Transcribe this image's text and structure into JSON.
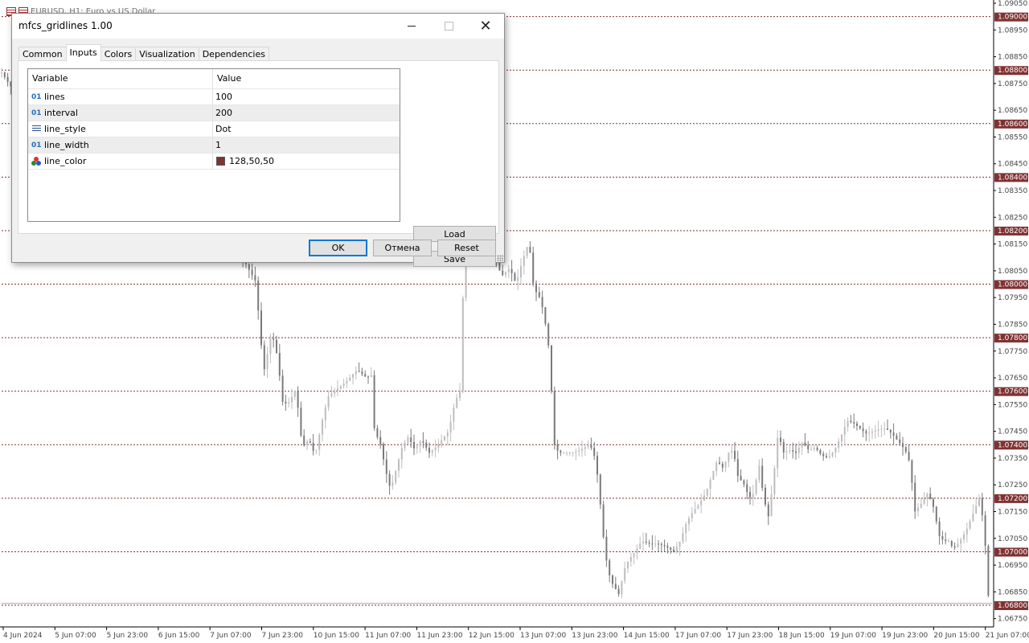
{
  "chart": {
    "symbol_title": "EURUSD, H1:  Euro vs US Dollar",
    "colors": {
      "bear_candle": "#7a7a7a",
      "bull_candle": "#bdbdbd",
      "gridline": "#803232",
      "label_bg": "#803232",
      "axis_text": "#444444"
    },
    "price_axis": {
      "min": 1.06725,
      "max": 1.0905
    },
    "price_labels": [
      "1.09050",
      "1.08950",
      "1.08850",
      "1.08750",
      "1.08650",
      "1.08550",
      "1.08450",
      "1.08350",
      "1.08250",
      "1.08150",
      "1.08050",
      "1.07950",
      "1.07850",
      "1.07750",
      "1.07650",
      "1.07550",
      "1.07450",
      "1.07350",
      "1.07250",
      "1.07150",
      "1.07050",
      "1.06950",
      "1.06850",
      "1.06750"
    ],
    "gridline_levels": [
      "1.09000",
      "1.08800",
      "1.08600",
      "1.08400",
      "1.08200",
      "1.08000",
      "1.07800",
      "1.07600",
      "1.07400",
      "1.07200",
      "1.07000",
      "1.06800"
    ],
    "time_labels": [
      "4 Jun 2024",
      "5 Jun 07:00",
      "5 Jun 23:00",
      "6 Jun 15:00",
      "7 Jun 07:00",
      "7 Jun 23:00",
      "10 Jun 15:00",
      "11 Jun 07:00",
      "11 Jun 23:00",
      "12 Jun 15:00",
      "13 Jun 07:00",
      "13 Jun 23:00",
      "14 Jun 15:00",
      "17 Jun 07:00",
      "17 Jun 23:00",
      "18 Jun 15:00",
      "19 Jun 07:00",
      "19 Jun 23:00",
      "20 Jun 15:00",
      "21 Jun 07:00"
    ],
    "last_price": 1.06807,
    "close_path": [
      [
        0,
        1.088
      ],
      [
        22,
        1.087
      ],
      [
        50,
        1.0865
      ],
      [
        80,
        1.0866
      ],
      [
        110,
        1.0865
      ],
      [
        140,
        1.0868
      ],
      [
        170,
        1.0864
      ],
      [
        200,
        1.0856
      ],
      [
        230,
        1.0848
      ],
      [
        260,
        1.0838
      ],
      [
        290,
        1.0816
      ],
      [
        318,
        1.0801
      ],
      [
        328,
        1.0767
      ],
      [
        338,
        1.0782
      ],
      [
        345,
        1.0773
      ],
      [
        352,
        1.0755
      ],
      [
        360,
        1.0756
      ],
      [
        368,
        1.0761
      ],
      [
        376,
        1.0739
      ],
      [
        384,
        1.0742
      ],
      [
        392,
        1.0736
      ],
      [
        400,
        1.0748
      ],
      [
        408,
        1.0758
      ],
      [
        420,
        1.0761
      ],
      [
        432,
        1.0764
      ],
      [
        444,
        1.0768
      ],
      [
        456,
        1.0765
      ],
      [
        462,
        1.0766
      ],
      [
        466,
        1.0744
      ],
      [
        472,
        1.0742
      ],
      [
        480,
        1.073
      ],
      [
        486,
        1.0723
      ],
      [
        492,
        1.073
      ],
      [
        500,
        1.0739
      ],
      [
        508,
        1.0743
      ],
      [
        516,
        1.0738
      ],
      [
        524,
        1.0742
      ],
      [
        534,
        1.0737
      ],
      [
        542,
        1.0739
      ],
      [
        550,
        1.0742
      ],
      [
        558,
        1.0745
      ],
      [
        566,
        1.0756
      ],
      [
        572,
        1.076
      ],
      [
        578,
        1.0815
      ],
      [
        592,
        1.0815
      ],
      [
        604,
        1.0812
      ],
      [
        614,
        1.0811
      ],
      [
        624,
        1.0803
      ],
      [
        634,
        1.0806
      ],
      [
        642,
        1.08
      ],
      [
        650,
        1.0809
      ],
      [
        658,
        1.0816
      ],
      [
        664,
        1.0798
      ],
      [
        670,
        1.0796
      ],
      [
        676,
        1.079
      ],
      [
        682,
        1.0778
      ],
      [
        686,
        1.076
      ],
      [
        690,
        1.0739
      ],
      [
        696,
        1.0737
      ],
      [
        704,
        1.0737
      ],
      [
        712,
        1.0737
      ],
      [
        722,
        1.0738
      ],
      [
        732,
        1.074
      ],
      [
        738,
        1.0738
      ],
      [
        744,
        1.0727
      ],
      [
        750,
        1.0707
      ],
      [
        756,
        1.0693
      ],
      [
        762,
        1.0688
      ],
      [
        770,
        1.0684
      ],
      [
        776,
        1.0693
      ],
      [
        782,
        1.0697
      ],
      [
        790,
        1.07
      ],
      [
        798,
        1.0704
      ],
      [
        808,
        1.0703
      ],
      [
        818,
        1.0703
      ],
      [
        828,
        1.0702
      ],
      [
        838,
        1.07
      ],
      [
        846,
        1.0704
      ],
      [
        854,
        1.0711
      ],
      [
        862,
        1.0715
      ],
      [
        870,
        1.0718
      ],
      [
        878,
        1.0722
      ],
      [
        886,
        1.0729
      ],
      [
        892,
        1.0734
      ],
      [
        900,
        1.0731
      ],
      [
        906,
        1.0737
      ],
      [
        912,
        1.0738
      ],
      [
        918,
        1.0728
      ],
      [
        926,
        1.0725
      ],
      [
        932,
        1.072
      ],
      [
        938,
        1.0722
      ],
      [
        944,
        1.0733
      ],
      [
        950,
        1.072
      ],
      [
        956,
        1.0713
      ],
      [
        962,
        1.0727
      ],
      [
        968,
        1.0745
      ],
      [
        974,
        1.0737
      ],
      [
        982,
        1.0738
      ],
      [
        990,
        1.0737
      ],
      [
        998,
        1.0741
      ],
      [
        1006,
        1.0738
      ],
      [
        1014,
        1.0739
      ],
      [
        1022,
        1.0736
      ],
      [
        1030,
        1.0735
      ],
      [
        1038,
        1.0738
      ],
      [
        1046,
        1.0743
      ],
      [
        1054,
        1.0749
      ],
      [
        1062,
        1.0748
      ],
      [
        1070,
        1.0746
      ],
      [
        1078,
        1.0744
      ],
      [
        1086,
        1.0745
      ],
      [
        1094,
        1.0746
      ],
      [
        1102,
        1.0746
      ],
      [
        1110,
        1.0744
      ],
      [
        1118,
        1.0741
      ],
      [
        1126,
        1.0738
      ],
      [
        1132,
        1.0733
      ],
      [
        1138,
        1.0715
      ],
      [
        1146,
        1.0718
      ],
      [
        1154,
        1.0722
      ],
      [
        1162,
        1.0716
      ],
      [
        1168,
        1.0706
      ],
      [
        1174,
        1.0704
      ],
      [
        1180,
        1.0704
      ],
      [
        1186,
        1.0701
      ],
      [
        1194,
        1.0704
      ],
      [
        1202,
        1.0708
      ],
      [
        1210,
        1.0714
      ],
      [
        1218,
        1.072
      ],
      [
        1224,
        1.071
      ],
      [
        1230,
        1.06807
      ]
    ]
  },
  "dialog": {
    "title": "mfcs_gridlines 1.00",
    "tabs": [
      {
        "label": "Common"
      },
      {
        "label": "Inputs",
        "active": true
      },
      {
        "label": "Colors"
      },
      {
        "label": "Visualization"
      },
      {
        "label": "Dependencies"
      }
    ],
    "grid": {
      "headers": [
        "Variable",
        "Value"
      ],
      "rows": [
        {
          "icon": "01",
          "icon_type": "integer-icon",
          "name": "lines",
          "value": "100"
        },
        {
          "icon": "01",
          "icon_type": "integer-icon",
          "name": "interval",
          "value": "200"
        },
        {
          "icon": "",
          "icon_type": "line-style-icon",
          "name": "line_style",
          "value": "Dot"
        },
        {
          "icon": "01",
          "icon_type": "integer-icon",
          "name": "line_width",
          "value": "1"
        },
        {
          "icon": "",
          "icon_type": "color-icon",
          "name": "line_color",
          "value": "128,50,50",
          "swatch_color": "#803232"
        }
      ]
    },
    "buttons": {
      "load": "Load",
      "save": "Save",
      "ok": "OK",
      "cancel": "Отмена",
      "reset": "Reset"
    }
  }
}
